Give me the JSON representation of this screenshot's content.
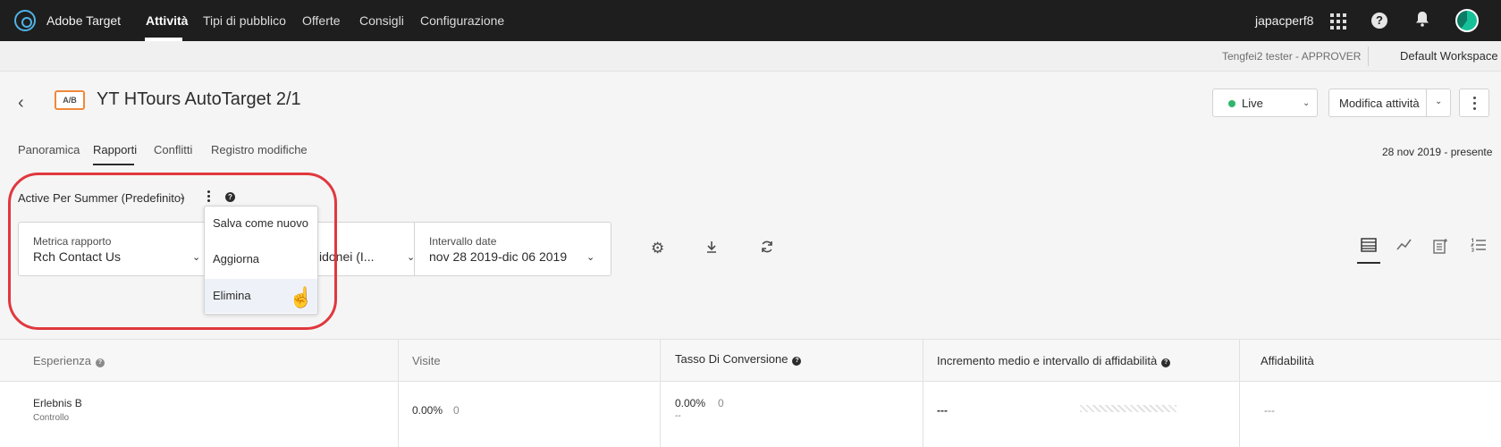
{
  "topnav": {
    "brand": "Adobe Target",
    "items": [
      "Attività",
      "Tipi di pubblico",
      "Offerte",
      "Consigli",
      "Configurazione"
    ],
    "user": "japacperf8"
  },
  "workspace": {
    "role": "Tengfei2 tester - APPROVER",
    "name": "Default Workspace"
  },
  "activity": {
    "badge": "A/B",
    "title": "YT HTours AutoTarget 2/1",
    "status": "Live",
    "edit_label": "Modifica attività",
    "date_range": "28 nov 2019 - presente"
  },
  "tabs": [
    "Panoramica",
    "Rapporti",
    "Conflitti",
    "Registro modifiche"
  ],
  "report": {
    "name": "Active Per Summer (Predefinito)",
    "help": "?",
    "menu": [
      "Salva come nuovo",
      "Aggiorna",
      "Elimina"
    ]
  },
  "filters": {
    "metric_label": "Metrica rapporto",
    "metric_value": "Rch Contact Us",
    "audience_value": "idonei (I...",
    "date_label": "Intervallo date",
    "date_value": "nov 28 2019-dic 06 2019"
  },
  "table": {
    "headers": [
      "Esperienza",
      "Visite",
      "Tasso Di Conversione",
      "Incremento medio e intervallo di affidabilità",
      "Affidabilità"
    ],
    "rows": [
      {
        "experience": "Erlebnis B",
        "sub": "Controllo",
        "visits_pct": "0.00%",
        "visits_count": "0",
        "conv_pct": "0.00%",
        "conv_count": "0",
        "conv_sub": "--",
        "lift": "---",
        "confidence": "---"
      }
    ]
  },
  "colors": {
    "topnav": "#1e1e1e",
    "live": "#2fb56a",
    "badge_border": "#f0883a",
    "highlight": "#e0383e"
  }
}
